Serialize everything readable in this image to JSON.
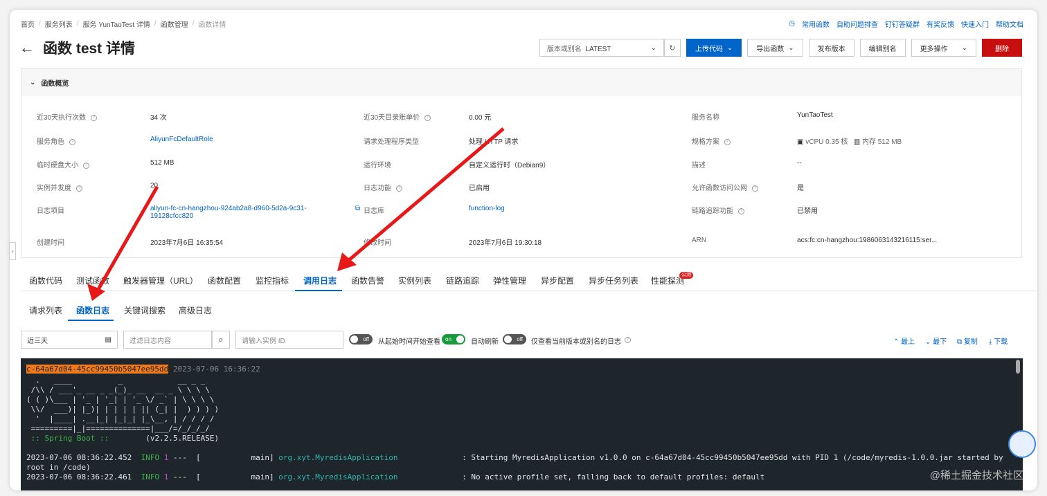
{
  "breadcrumb": [
    "首页",
    "服务列表",
    "服务 YunTaoTest 详情",
    "函数管理",
    "函数详情"
  ],
  "top_links": [
    "常用函数",
    "自助问题排查",
    "钉钉答疑群",
    "有奖反馈",
    "快速入门",
    "帮助文档"
  ],
  "title": "函数 test 详情",
  "version_select": {
    "label": "版本或别名",
    "value": "LATEST"
  },
  "actions": {
    "upload": "上传代码",
    "export": "导出函数",
    "publish": "发布版本",
    "edit_alias": "编辑别名",
    "more": "更多操作",
    "delete": "删除"
  },
  "overview": {
    "header": "函数概览",
    "rows": [
      {
        "k1": "近30天执行次数",
        "v1": "34 次",
        "k2": "近30天目录账单价",
        "v2": "0.00 元",
        "k3": "服务名称",
        "v3": "YunTaoTest"
      },
      {
        "k1": "服务角色",
        "v1": "AliyunFcDefaultRole",
        "k2": "请求处理程序类型",
        "v2": "处理 HTTP 请求",
        "k3": "规格方案",
        "v3a": "vCPU 0.35 核",
        "v3b": "内存 512 MB"
      },
      {
        "k1": "临时硬盘大小",
        "v1": "512 MB",
        "k2": "运行环境",
        "v2": "自定义运行时（Debian9）",
        "k3": "描述",
        "v3": "--"
      },
      {
        "k1": "实例并发度",
        "v1": "20",
        "k2": "日志功能",
        "v2": "已启用",
        "k3": "允许函数访问公网",
        "v3": "是"
      },
      {
        "k1": "日志项目",
        "v1": "aliyun-fc-cn-hangzhou-924ab2a8-d960-5d2a-9c31-",
        "v1b": "19128cfcc820",
        "k2": "日志库",
        "v2": "function-log",
        "k3": "链路追踪功能",
        "v3": "已禁用"
      },
      {
        "k1": "创建时间",
        "v1": "2023年7月6日 16:35:54",
        "k2": "修改时间",
        "v2": "2023年7月6日 19:30:18",
        "k3": "ARN",
        "v3": "acs:fc:cn-hangzhou:1986063143216115:ser..."
      }
    ]
  },
  "tabs": [
    "函数代码",
    "测试函数",
    "触发器管理（URL）",
    "函数配置",
    "监控指标",
    "调用日志",
    "函数告警",
    "实例列表",
    "链路追踪",
    "弹性管理",
    "异步配置",
    "异步任务列表",
    "性能探测"
  ],
  "tab_badge": "公测",
  "subtabs": [
    "请求列表",
    "函数日志",
    "关键词搜索",
    "高级日志"
  ],
  "filters": {
    "range": "近三天",
    "log_placeholder": "过滤日志内容",
    "instance_placeholder": "请输入实例 ID",
    "toggle1": {
      "state": "off",
      "label": "从起始时间开始查看"
    },
    "toggle2": {
      "state": "on",
      "label": "自动刷新"
    },
    "toggle3": {
      "state": "off",
      "label": "仅查看当前版本或别名的日志"
    },
    "nav": [
      "最上",
      "最下",
      "复制",
      "下载"
    ]
  },
  "console": {
    "instance_id": "c-64a67d04-45cc99450b5047ee95dd",
    "instance_time": "2023-07-06 16:36:22",
    "banner": [
      "  .   ____          _            __ _ _",
      " /\\\\ / ___'_ __ _ _(_)_ __  __ _ \\ \\ \\ \\",
      "( ( )\\___ | '_ | '_| | '_ \\/ _` | \\ \\ \\ \\",
      " \\\\/  ___)| |_)| | | | | || (_| |  ) ) ) )",
      "  '  |____| .__|_| |_|_| |_\\__, | / / / /",
      " =========|_|==============|___/=/_/_/_/"
    ],
    "spring": " :: Spring Boot ::",
    "spring_version": "(v2.2.5.RELEASE)",
    "lines": [
      {
        "ts": "2023-07-06 08:36:22.452",
        "level": "INFO",
        "pid": "1",
        "thread": "---  [           main]",
        "logger": "org.xyt.MyredisApplication",
        "msg": ": Starting MyredisApplication v1.0.0 on c-64a67d04-45cc99450b5047ee95dd with PID 1 (/code/myredis-1.0.0.jar started by",
        "msg2": "root in /code)"
      },
      {
        "ts": "2023-07-06 08:36:22.461",
        "level": "INFO",
        "pid": "1",
        "thread": "---  [           main]",
        "logger": "org.xyt.MyredisApplication",
        "msg": ": No active profile set, falling back to default profiles: default"
      }
    ]
  },
  "watermark": "@稀土掘金技术社区",
  "colors": {
    "primary": "#0064c8",
    "danger": "#c80f0f",
    "arrow": "#e81818",
    "console_bg": "#1e252b"
  }
}
